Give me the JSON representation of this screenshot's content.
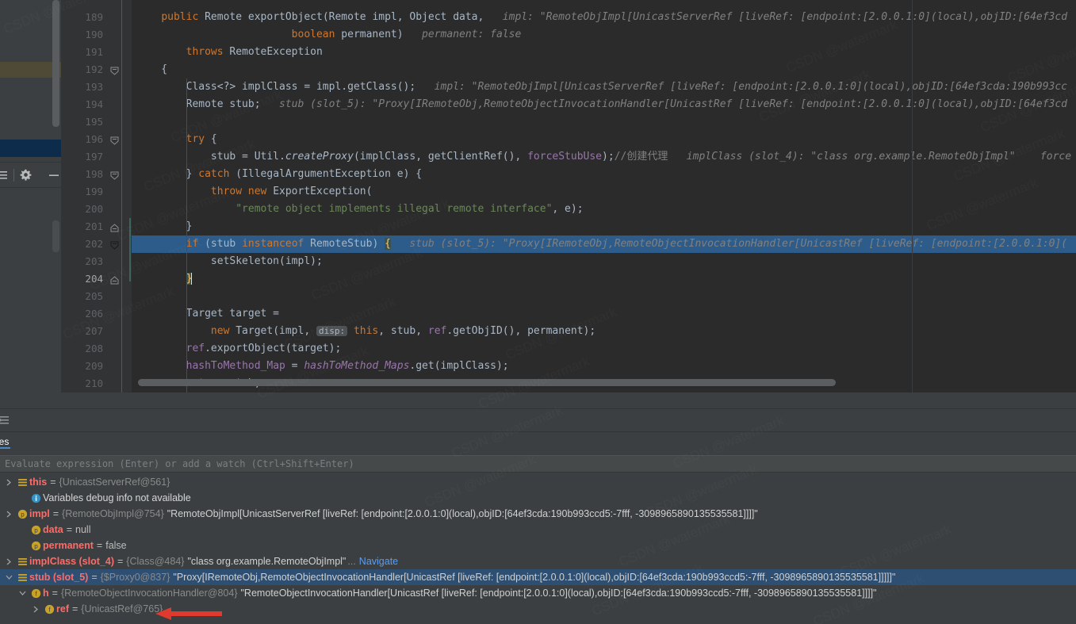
{
  "left_panel": {
    "toolbar_icons": [
      "collapse-all-icon",
      "settings-gear-icon",
      "minimize-icon"
    ]
  },
  "editor": {
    "lines": [
      {
        "num": "189",
        "fold": "",
        "current": false,
        "selected": false,
        "indent": 0,
        "segments": [
          {
            "t": "    ",
            "c": "plain"
          },
          {
            "t": "public",
            "c": "kw"
          },
          {
            "t": " Remote ",
            "c": "plain"
          },
          {
            "t": "exportObject",
            "c": "plain"
          },
          {
            "t": "(Remote impl, Object data, ",
            "c": "plain"
          },
          {
            "t": "  impl: \"RemoteObjImpl[UnicastServerRef [liveRef: [endpoint:[2.0.0.1:0](local),objID:[64ef3cd",
            "c": "hint"
          }
        ]
      },
      {
        "num": "190",
        "fold": "",
        "current": false,
        "selected": false,
        "indent": 0,
        "segments": [
          {
            "t": "                         ",
            "c": "plain"
          },
          {
            "t": "boolean",
            "c": "kw"
          },
          {
            "t": " permanent)",
            "c": "plain"
          },
          {
            "t": "   permanent: false",
            "c": "hint"
          }
        ]
      },
      {
        "num": "191",
        "fold": "",
        "current": false,
        "selected": false,
        "indent": 0,
        "segments": [
          {
            "t": "        ",
            "c": "plain"
          },
          {
            "t": "throws",
            "c": "kw"
          },
          {
            "t": " RemoteException",
            "c": "plain"
          }
        ]
      },
      {
        "num": "192",
        "fold": "minus",
        "current": false,
        "selected": false,
        "indent": 0,
        "segments": [
          {
            "t": "    {",
            "c": "plain"
          }
        ]
      },
      {
        "num": "193",
        "fold": "",
        "current": false,
        "selected": false,
        "indent": 1,
        "segments": [
          {
            "t": "        Class<?> implClass = impl.getClass();",
            "c": "plain"
          },
          {
            "t": "   impl: \"RemoteObjImpl[UnicastServerRef [liveRef: [endpoint:[2.0.0.1:0](local),objID:[64ef3cda:190b993cc",
            "c": "hint"
          }
        ]
      },
      {
        "num": "194",
        "fold": "",
        "current": false,
        "selected": false,
        "indent": 1,
        "segments": [
          {
            "t": "        Remote stub;",
            "c": "plain"
          },
          {
            "t": "   stub (slot_5): \"Proxy[IRemoteObj,RemoteObjectInvocationHandler[UnicastRef [liveRef: [endpoint:[2.0.0.1:0](local),objID:[64ef3cd",
            "c": "hint"
          }
        ]
      },
      {
        "num": "195",
        "fold": "",
        "current": false,
        "selected": false,
        "indent": 1,
        "segments": []
      },
      {
        "num": "196",
        "fold": "minus",
        "current": false,
        "selected": false,
        "indent": 1,
        "segments": [
          {
            "t": "        ",
            "c": "plain"
          },
          {
            "t": "try",
            "c": "kw"
          },
          {
            "t": " {",
            "c": "plain"
          }
        ]
      },
      {
        "num": "197",
        "fold": "",
        "current": false,
        "selected": false,
        "indent": 2,
        "segments": [
          {
            "t": "            stub = Util.",
            "c": "plain"
          },
          {
            "t": "createProxy",
            "c": "ital"
          },
          {
            "t": "(implClass, getClientRef(), ",
            "c": "plain"
          },
          {
            "t": "forceStubUse",
            "c": "fld"
          },
          {
            "t": ");",
            "c": "plain"
          },
          {
            "t": "//创建代理",
            "c": "cmt"
          },
          {
            "t": "   implClass (slot_4): \"class org.example.RemoteObjImpl\"    force",
            "c": "hint"
          }
        ]
      },
      {
        "num": "198",
        "fold": "minus",
        "current": false,
        "selected": false,
        "indent": 1,
        "segments": [
          {
            "t": "        } ",
            "c": "plain"
          },
          {
            "t": "catch",
            "c": "kw"
          },
          {
            "t": " (IllegalArgumentException e) {",
            "c": "plain"
          }
        ]
      },
      {
        "num": "199",
        "fold": "",
        "current": false,
        "selected": false,
        "indent": 2,
        "segments": [
          {
            "t": "            ",
            "c": "plain"
          },
          {
            "t": "throw",
            "c": "kw"
          },
          {
            "t": " ",
            "c": "plain"
          },
          {
            "t": "new",
            "c": "kw"
          },
          {
            "t": " ExportException(",
            "c": "plain"
          }
        ]
      },
      {
        "num": "200",
        "fold": "",
        "current": false,
        "selected": false,
        "indent": 2,
        "segments": [
          {
            "t": "                ",
            "c": "plain"
          },
          {
            "t": "\"remote object implements illegal remote interface\"",
            "c": "str"
          },
          {
            "t": ", e);",
            "c": "plain"
          }
        ]
      },
      {
        "num": "201",
        "fold": "plus",
        "current": false,
        "selected": false,
        "indent": 1,
        "segments": [
          {
            "t": "        }",
            "c": "plain"
          }
        ]
      },
      {
        "num": "202",
        "fold": "minus-dark",
        "current": false,
        "selected": true,
        "indent": 1,
        "segments": [
          {
            "t": "        ",
            "c": "plain"
          },
          {
            "t": "if",
            "c": "kw"
          },
          {
            "t": " (stub ",
            "c": "plain"
          },
          {
            "t": "instanceof",
            "c": "kw"
          },
          {
            "t": " RemoteStub) ",
            "c": "plain"
          },
          {
            "t": "{",
            "c": "brace"
          },
          {
            "t": "   stub (slot_5): \"Proxy[IRemoteObj,RemoteObjectInvocationHandler[UnicastRef [liveRef: [endpoint:[2.0.0.1:0](",
            "c": "hint"
          }
        ]
      },
      {
        "num": "203",
        "fold": "",
        "current": false,
        "selected": false,
        "indent": 2,
        "segments": [
          {
            "t": "            setSkeleton(impl);",
            "c": "plain"
          }
        ]
      },
      {
        "num": "204",
        "fold": "plus",
        "current": true,
        "selected": false,
        "indent": 1,
        "segments": [
          {
            "t": "        ",
            "c": "plain"
          },
          {
            "t": "}",
            "c": "brace"
          }
        ]
      },
      {
        "num": "205",
        "fold": "",
        "current": false,
        "selected": false,
        "indent": 1,
        "segments": []
      },
      {
        "num": "206",
        "fold": "",
        "current": false,
        "selected": false,
        "indent": 1,
        "segments": [
          {
            "t": "        Target target =",
            "c": "plain"
          }
        ]
      },
      {
        "num": "207",
        "fold": "",
        "current": false,
        "selected": false,
        "indent": 2,
        "segments": [
          {
            "t": "            ",
            "c": "plain"
          },
          {
            "t": "new",
            "c": "kw"
          },
          {
            "t": " Target(impl, ",
            "c": "plain"
          },
          {
            "t": "disp:",
            "c": "chip"
          },
          {
            "t": " ",
            "c": "plain"
          },
          {
            "t": "this",
            "c": "kw"
          },
          {
            "t": ", stub, ",
            "c": "plain"
          },
          {
            "t": "ref",
            "c": "fld"
          },
          {
            "t": ".getObjID(), permanent);",
            "c": "plain"
          }
        ]
      },
      {
        "num": "208",
        "fold": "",
        "current": false,
        "selected": false,
        "indent": 1,
        "segments": [
          {
            "t": "        ",
            "c": "plain"
          },
          {
            "t": "ref",
            "c": "fld"
          },
          {
            "t": ".exportObject(target);",
            "c": "plain"
          }
        ]
      },
      {
        "num": "209",
        "fold": "",
        "current": false,
        "selected": false,
        "indent": 1,
        "segments": [
          {
            "t": "        ",
            "c": "plain"
          },
          {
            "t": "hashToMethod_Map",
            "c": "fld"
          },
          {
            "t": " = ",
            "c": "plain"
          },
          {
            "t": "hashToMethod_Maps",
            "c": "fld-ital"
          },
          {
            "t": ".get(implClass);",
            "c": "plain"
          }
        ]
      },
      {
        "num": "210",
        "fold": "",
        "current": false,
        "selected": false,
        "indent": 1,
        "segments": [
          {
            "t": "        ",
            "c": "plain"
          },
          {
            "t": "return",
            "c": "kw"
          },
          {
            "t": " stub;",
            "c": "plain"
          }
        ]
      }
    ]
  },
  "debug_panel": {
    "tab_label": "iables",
    "toolbar_icon": "collapse-all-icon",
    "watch_placeholder": "Evaluate expression (Enter) or add a watch (Ctrl+Shift+Enter)",
    "rows": [
      {
        "indent": 0,
        "twisty": "collapsed",
        "icon": "local-variable-icon",
        "name": "this",
        "eq": "=",
        "ref": "{UnicastServerRef@561}",
        "value": "",
        "navigate": "",
        "selected": false,
        "kind": "var"
      },
      {
        "indent": 1,
        "twisty": "none",
        "icon": "info-icon",
        "name": "",
        "eq": "",
        "ref": "",
        "value": "Variables debug info not available",
        "navigate": "",
        "selected": false,
        "kind": "info"
      },
      {
        "indent": 0,
        "twisty": "collapsed",
        "icon": "parameter-icon",
        "name": "impl",
        "eq": "=",
        "ref": "{RemoteObjImpl@754}",
        "value": "\"RemoteObjImpl[UnicastServerRef [liveRef: [endpoint:[2.0.0.1:0](local),objID:[64ef3cda:190b993ccd5:-7fff, -3098965890135535581]]]]\"",
        "navigate": "",
        "selected": false,
        "kind": "var"
      },
      {
        "indent": 1,
        "twisty": "none",
        "icon": "parameter-icon",
        "name": "data",
        "eq": "=",
        "ref": "",
        "value": "null",
        "navigate": "",
        "selected": false,
        "kind": "null"
      },
      {
        "indent": 1,
        "twisty": "none",
        "icon": "parameter-icon",
        "name": "permanent",
        "eq": "=",
        "ref": "",
        "value": "false",
        "navigate": "",
        "selected": false,
        "kind": "null"
      },
      {
        "indent": 0,
        "twisty": "collapsed",
        "icon": "local-variable-icon",
        "name": "implClass (slot_4)",
        "eq": "=",
        "ref": "{Class@484}",
        "value": "\"class org.example.RemoteObjImpl\"",
        "navigate": "Navigate",
        "selected": false,
        "kind": "var"
      },
      {
        "indent": 0,
        "twisty": "expanded",
        "icon": "local-variable-icon",
        "name": "stub (slot_5)",
        "eq": "=",
        "ref": "{$Proxy0@837}",
        "value": "\"Proxy[IRemoteObj,RemoteObjectInvocationHandler[UnicastRef [liveRef: [endpoint:[2.0.0.1:0](local),objID:[64ef3cda:190b993ccd5:-7fff, -3098965890135535581]]]]]\"",
        "navigate": "",
        "selected": true,
        "kind": "var"
      },
      {
        "indent": 1,
        "twisty": "expanded",
        "icon": "field-icon",
        "name": "h",
        "eq": "=",
        "ref": "{RemoteObjectInvocationHandler@804}",
        "value": "\"RemoteObjectInvocationHandler[UnicastRef [liveRef: [endpoint:[2.0.0.1:0](local),objID:[64ef3cda:190b993ccd5:-7fff, -3098965890135535581]]]]\"",
        "navigate": "",
        "selected": false,
        "kind": "var"
      },
      {
        "indent": 2,
        "twisty": "collapsed",
        "icon": "field-icon",
        "name": "ref",
        "eq": "=",
        "ref": "{UnicastRef@765}",
        "value": "",
        "navigate": "",
        "selected": false,
        "kind": "var"
      }
    ],
    "annotation": {
      "name": "red-arrow-annotation",
      "color": "#e03a2f"
    }
  },
  "colors": {
    "editor_bg": "#2b2b2b",
    "gutter_bg": "#313335",
    "panel_bg": "#3c3f41",
    "selection_blue": "#2d5c8a",
    "row_selected": "#2e4f72",
    "keyword_orange": "#cc7832",
    "string_green": "#6a8759",
    "field_purple": "#9876aa",
    "hint_gray": "#808080",
    "var_name_red": "#ff6b68",
    "link_blue": "#589df6",
    "arrow_red": "#e03a2f"
  }
}
